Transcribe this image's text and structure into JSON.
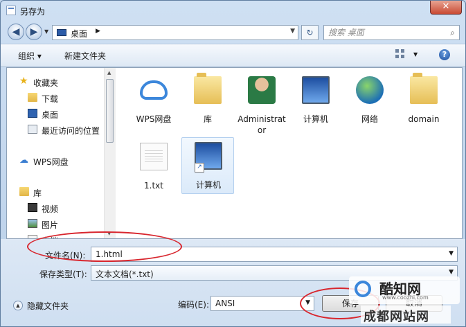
{
  "window": {
    "title": "另存为",
    "close_glyph": "✕"
  },
  "address": {
    "location": "桌面",
    "search_placeholder": "搜索 桌面"
  },
  "toolbar": {
    "organize_label": "组织 ▾",
    "new_folder_label": "新建文件夹"
  },
  "nav": {
    "items": [
      {
        "label": "收藏夹",
        "icon": "star-icon"
      },
      {
        "label": "下载",
        "icon": "download-folder-icon"
      },
      {
        "label": "桌面",
        "icon": "desktop-icon"
      },
      {
        "label": "最近访问的位置",
        "icon": "recent-places-icon"
      },
      {
        "label": "WPS网盘",
        "icon": "cloud-icon"
      },
      {
        "label": "库",
        "icon": "library-icon"
      },
      {
        "label": "视频",
        "icon": "video-icon"
      },
      {
        "label": "图片",
        "icon": "pictures-icon"
      },
      {
        "label": "文档",
        "icon": "documents-icon"
      }
    ]
  },
  "files": [
    {
      "label": "WPS网盘",
      "icon": "cloud-icon"
    },
    {
      "label": "库",
      "icon": "library-folder-icon"
    },
    {
      "label": "Administrator",
      "icon": "user-folder-icon"
    },
    {
      "label": "计算机",
      "icon": "computer-icon"
    },
    {
      "label": "网络",
      "icon": "network-icon"
    },
    {
      "label": "domain",
      "icon": "folder-icon"
    },
    {
      "label": "1.txt",
      "icon": "text-file-icon"
    },
    {
      "label": "计算机",
      "icon": "computer-shortcut-icon",
      "selected": true
    }
  ],
  "form": {
    "filename_label": "文件名(N):",
    "filename_value": "1.html",
    "filetype_label": "保存类型(T):",
    "filetype_value": "文本文档(*.txt)",
    "encoding_label": "编码(E):",
    "encoding_value": "ANSI",
    "hide_folders_label": "隐藏文件夹",
    "save_label": "保存",
    "cancel_label": "取消"
  },
  "watermark": {
    "brand": "酷知网",
    "url": "www.coozhi.com",
    "site": "成都网站网"
  },
  "colors": {
    "annotation": "#d8262e",
    "accent": "#3c87db"
  }
}
